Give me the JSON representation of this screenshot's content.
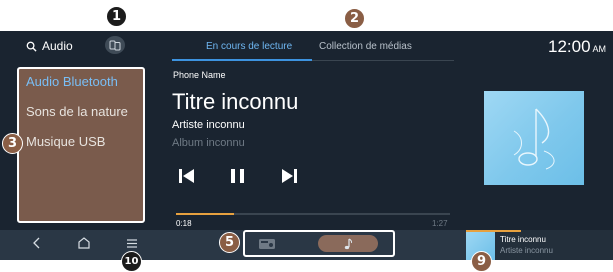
{
  "header": {
    "search_label": "Audio",
    "tabs": [
      "En cours de lecture",
      "Collection de médias"
    ],
    "clock": "12:00",
    "ampm": "AM"
  },
  "sidebar": {
    "items": [
      "Audio Bluetooth",
      "Sons de la nature",
      "Musique USB"
    ]
  },
  "player": {
    "source_name": "Phone Name",
    "title": "Titre inconnu",
    "artist": "Artiste inconnu",
    "album": "Album inconnu",
    "elapsed": "0:18",
    "total": "1:27",
    "progress": 0.21
  },
  "mini_player": {
    "title": "Titre inconnu",
    "artist": "Artiste inconnu"
  },
  "callouts": [
    "1",
    "2",
    "3",
    "5",
    "9",
    "10"
  ],
  "icons": [
    "search-icon",
    "source-switch-icon",
    "previous-icon",
    "pause-icon",
    "next-icon",
    "album-art-music-icon",
    "back-icon",
    "home-icon",
    "menu-icon",
    "radio-icon",
    "music-note-icon"
  ],
  "colors": {
    "accent": "#3d93df",
    "highlight": "#e7a13f",
    "sidebar_bg": "#7a5b4c",
    "screen_bg": "#1a2430"
  }
}
